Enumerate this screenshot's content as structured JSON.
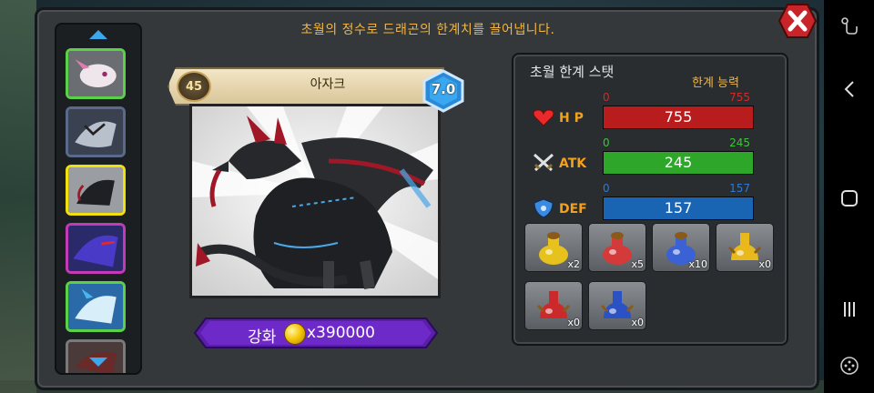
{
  "instruction": "초월의 정수로 드래곤의 한계치를 끌어냅니다.",
  "dragon": {
    "name": "아자크",
    "level": "45",
    "grade": "7.0"
  },
  "enhance": {
    "label": "강화",
    "cost": "x390000"
  },
  "stats_panel": {
    "title": "초월 한계 스탯",
    "subtitle": "한계 능력",
    "stats": [
      {
        "label": "H P",
        "min": "0",
        "max": "755",
        "value": "755",
        "fill": 1.0,
        "color": "#b81c1c",
        "range_color": "#d02a2a",
        "icon": "heart-icon"
      },
      {
        "label": "ATK",
        "min": "0",
        "max": "245",
        "value": "245",
        "fill": 1.0,
        "color": "#2ea62a",
        "range_color": "#3ec43a",
        "icon": "crossed-swords-icon"
      },
      {
        "label": "DEF",
        "min": "0",
        "max": "157",
        "value": "157",
        "fill": 1.0,
        "color": "#1a64b4",
        "range_color": "#2a7ad6",
        "icon": "shield-icon"
      }
    ]
  },
  "potions": [
    {
      "count": "x2",
      "color": "#e8c21c",
      "icon": "gold-potion-icon"
    },
    {
      "count": "x5",
      "color": "#d43a3a",
      "icon": "red-potion-icon"
    },
    {
      "count": "x10",
      "color": "#3a62d4",
      "icon": "blue-potion-icon"
    },
    {
      "count": "x0",
      "color": "#e8b81c",
      "icon": "gold-ornate-potion-icon"
    },
    {
      "count": "x0",
      "color": "#cc2a2a",
      "icon": "red-ornate-potion-icon"
    },
    {
      "count": "x0",
      "color": "#2a52c4",
      "icon": "blue-ornate-potion-icon"
    }
  ]
}
